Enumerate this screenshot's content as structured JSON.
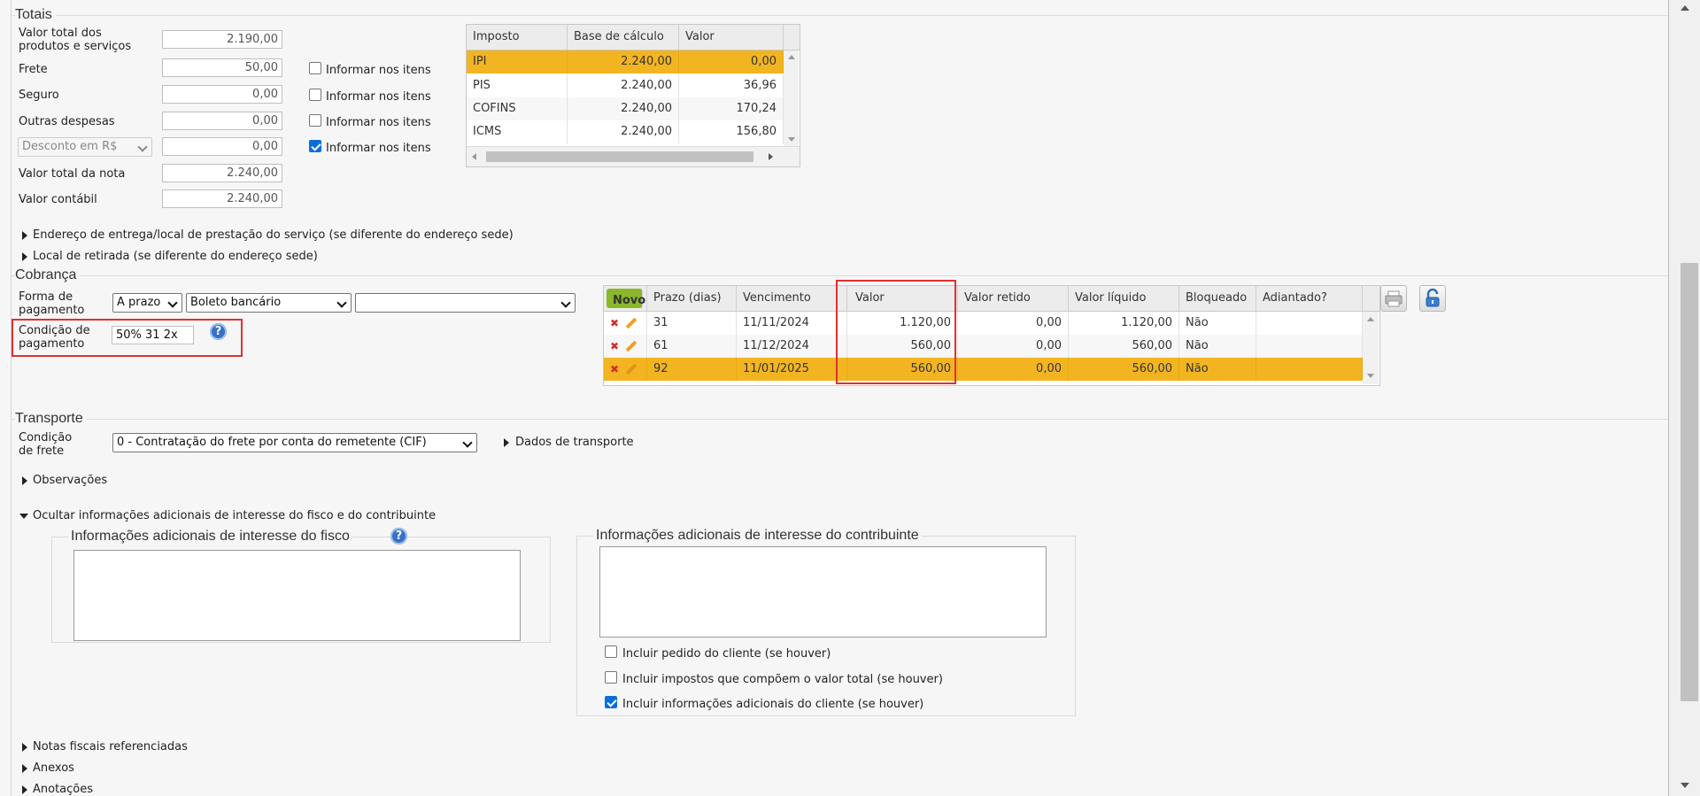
{
  "totais": {
    "title": "Totais",
    "rows": [
      {
        "label": "Valor total dos produtos e serviços",
        "value": "2.190,00"
      },
      {
        "label": "Frete",
        "value": "50,00"
      },
      {
        "label": "Seguro",
        "value": "0,00"
      },
      {
        "label": "Outras despesas",
        "value": "0,00"
      },
      {
        "label": "Desconto em R$",
        "value": "0,00"
      },
      {
        "label": "Valor total da nota",
        "value": "2.240,00"
      },
      {
        "label": "Valor contábil",
        "value": "2.240,00"
      }
    ],
    "informar_label": "Informar nos itens",
    "informar_checked": [
      false,
      false,
      false,
      true
    ]
  },
  "impostos": {
    "headers": [
      "Imposto",
      "Base de cálculo",
      "Valor"
    ],
    "rows": [
      [
        "IPI",
        "2.240,00",
        "0,00"
      ],
      [
        "PIS",
        "2.240,00",
        "36,96"
      ],
      [
        "COFINS",
        "2.240,00",
        "170,24"
      ],
      [
        "ICMS",
        "2.240,00",
        "156,80"
      ]
    ]
  },
  "expanders": {
    "endereco": "Endereço de entrega/local de prestação do serviço (se diferente do endereço sede)",
    "retirada": "Local de retirada (se diferente do endereço sede)",
    "observacoes": "Observações",
    "ocultar": "Ocultar informações adicionais de interesse do fisco e do contribuinte",
    "notas": "Notas fiscais referenciadas",
    "anexos": "Anexos",
    "anotacoes": "Anotações",
    "dados_transporte": "Dados de transporte"
  },
  "cobranca": {
    "title": "Cobrança",
    "forma_label": "Forma de pagamento",
    "forma_value": "A prazo",
    "meio_value": "Boleto bancário",
    "extra_value": "",
    "condicao_label": "Condição de pagamento",
    "condicao_value": "50% 31 2x",
    "novo_label": "Novo",
    "headers": [
      "Prazo (dias)",
      "Vencimento",
      "Valor",
      "Valor retido",
      "Valor líquido",
      "Bloqueado",
      "Adiantado?"
    ],
    "rows": [
      [
        "31",
        "11/11/2024",
        "1.120,00",
        "0,00",
        "1.120,00",
        "Não",
        ""
      ],
      [
        "61",
        "11/12/2024",
        "560,00",
        "0,00",
        "560,00",
        "Não",
        ""
      ],
      [
        "92",
        "11/01/2025",
        "560,00",
        "0,00",
        "560,00",
        "Não",
        ""
      ]
    ]
  },
  "transporte": {
    "title": "Transporte",
    "condicao_label": "Condição de frete",
    "condicao_value": "0 - Contratação do frete por conta do remetente (CIF)"
  },
  "info": {
    "fisco_title": "Informações adicionais de interesse do fisco",
    "contrib_title": "Informações adicionais de interesse do contribuinte",
    "fisco_text": "",
    "contrib_text": "",
    "checks": [
      {
        "label": "Incluir pedido do cliente (se houver)",
        "checked": false
      },
      {
        "label": "Incluir impostos que compõem o valor total (se houver)",
        "checked": false
      },
      {
        "label": "Incluir informações adicionais do cliente (se houver)",
        "checked": true
      }
    ]
  },
  "colors": {
    "selected_row": "#f2b521",
    "accent": "#0a6fdb",
    "highlight_box": "#e03030",
    "novo": "#8ab82a"
  },
  "icons": {
    "help": "question-mark-circle",
    "print": "printer-icon",
    "lock": "lock-icon",
    "delete": "x-icon",
    "edit": "pencil-icon"
  }
}
